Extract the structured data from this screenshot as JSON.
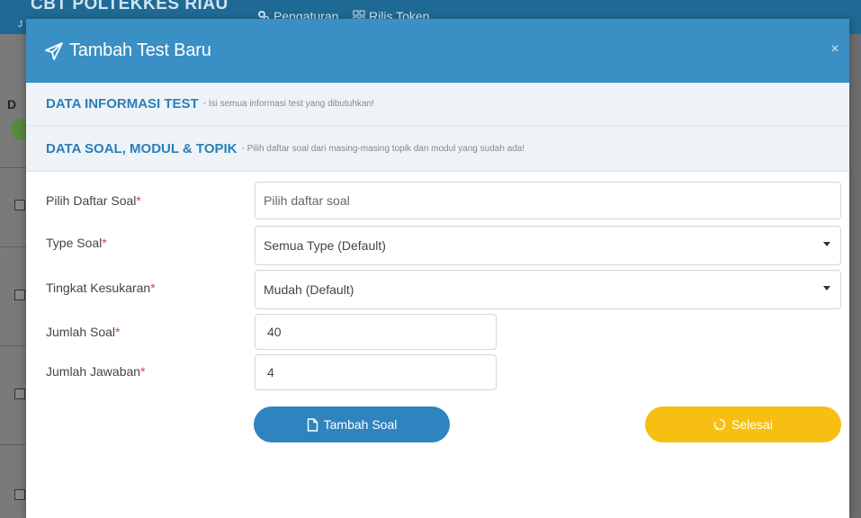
{
  "background": {
    "brand": "CBT POLTEKKES RIAU",
    "brand_sub": "J",
    "nav": [
      {
        "label": "Pengaturan",
        "icon": "gears-icon"
      },
      {
        "label": "Rilis Token",
        "icon": "grid-icon"
      }
    ],
    "side_letter": "D"
  },
  "modal": {
    "title": "Tambah Test Baru",
    "title_icon": "paper-plane-icon",
    "close_label": "×",
    "sections": [
      {
        "title": "DATA INFORMASI TEST",
        "subtitle": "Isi semua informasi test yang dibutuhkan!"
      },
      {
        "title": "DATA SOAL, MODUL & TOPIK",
        "subtitle": "Pilih daftar soal dari masing-masing topik dan modul yang sudah ada!"
      }
    ],
    "form": {
      "daftar_soal": {
        "label": "Pilih Daftar Soal",
        "placeholder": "Pilih daftar soal",
        "value": ""
      },
      "type_soal": {
        "label": "Type Soal",
        "value": "Semua Type (Default)"
      },
      "tingkat": {
        "label": "Tingkat Kesukaran",
        "value": "Mudah (Default)"
      },
      "jumlah_soal": {
        "label": "Jumlah Soal",
        "value": "40"
      },
      "jumlah_jawaban": {
        "label": "Jumlah Jawaban",
        "value": "4"
      },
      "required_mark": "*"
    },
    "buttons": {
      "tambah_soal": {
        "label": "Tambah Soal",
        "icon": "file-icon",
        "color": "#2f84bf"
      },
      "selesai": {
        "label": "Selesai",
        "icon": "spinner-icon",
        "color": "#f6bf12"
      }
    }
  },
  "colors": {
    "header": "#3a8fc4",
    "section_title": "#2a7fb8",
    "required": "#e04040"
  }
}
